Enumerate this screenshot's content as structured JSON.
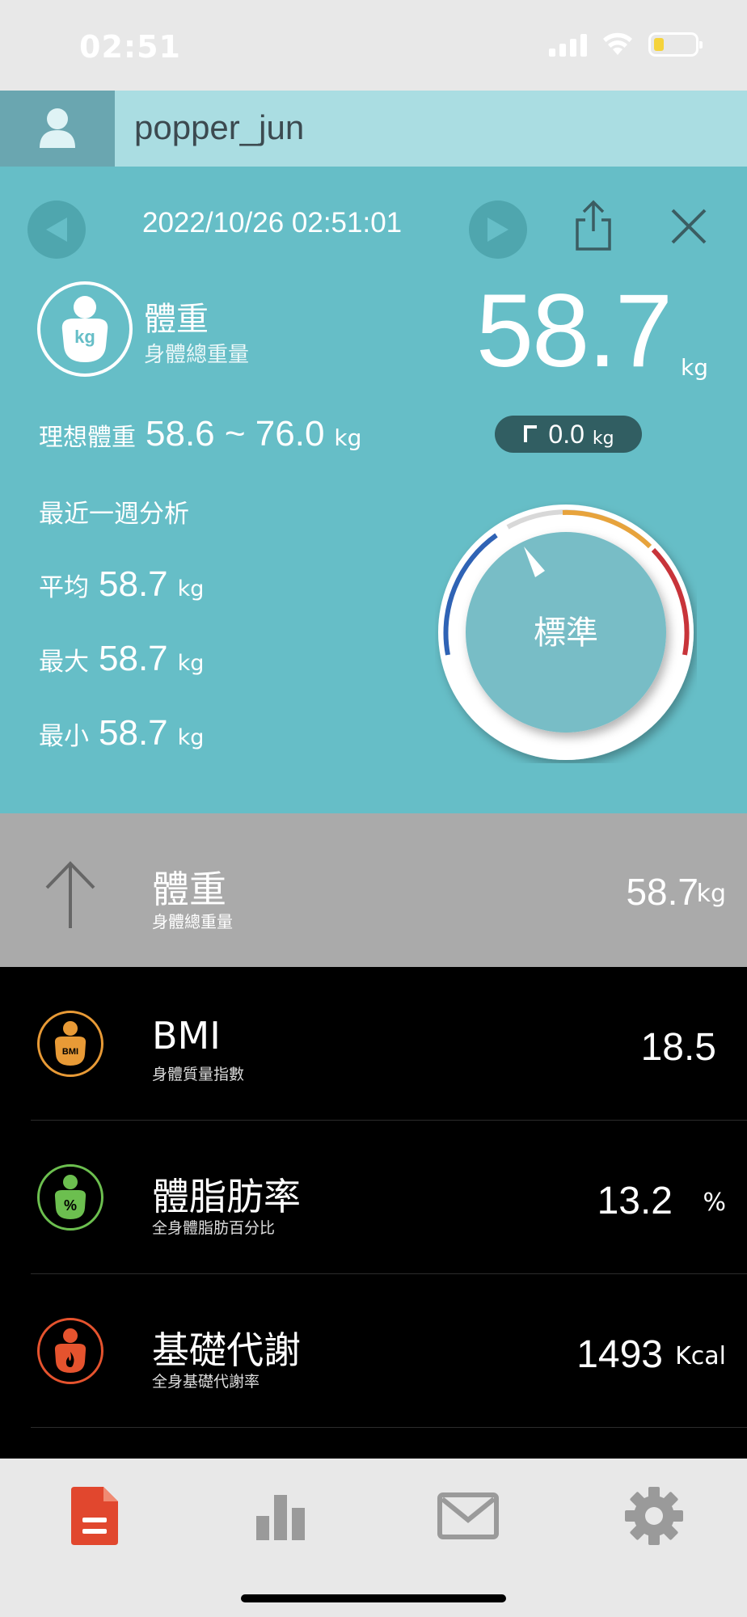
{
  "status_bar": {
    "time": "02:51"
  },
  "user": {
    "name": "popper_jun"
  },
  "header": {
    "datetime": "2022/10/26 02:51:01"
  },
  "weight": {
    "title": "體重",
    "subtitle": "身體總重量",
    "badge_text": "kg",
    "value": "58.7",
    "unit": "kg"
  },
  "ideal": {
    "label": "理想體重",
    "range": "58.6 ~ 76.0",
    "unit": "kg"
  },
  "delta": {
    "value": "0.0",
    "unit": "kg"
  },
  "week": {
    "title": "最近一週分析",
    "stats": [
      {
        "label": "平均",
        "value": "58.7",
        "unit": "kg"
      },
      {
        "label": "最大",
        "value": "58.7",
        "unit": "kg"
      },
      {
        "label": "最小",
        "value": "58.7",
        "unit": "kg"
      }
    ]
  },
  "gauge": {
    "label": "標準",
    "colors": {
      "low": "#2f63b5",
      "normal": "#e7a33c",
      "high": "#c8343a"
    }
  },
  "highlight": {
    "title": "體重",
    "subtitle": "身體總重量",
    "value": "58.7",
    "unit": "kg"
  },
  "list": [
    {
      "title": "BMI",
      "subtitle": "身體質量指數",
      "value": "18.5",
      "unit": "",
      "icon": "bmi-icon",
      "badge_text": "BMI",
      "color": "#e89a36"
    },
    {
      "title": "體脂肪率",
      "subtitle": "全身體脂肪百分比",
      "value": "13.2",
      "unit": "%",
      "icon": "body-fat-icon",
      "badge_text": "%",
      "color": "#6cbf4f"
    },
    {
      "title": "基礎代謝",
      "subtitle": "全身基礎代謝率",
      "value": "1493",
      "unit": "Kcal",
      "icon": "metabolism-icon",
      "badge_text": "",
      "color": "#e5532e"
    }
  ],
  "tabs": [
    {
      "name": "report",
      "icon": "report-icon",
      "active": true,
      "color": "#e1472e"
    },
    {
      "name": "chart",
      "icon": "bar-chart-icon",
      "active": false,
      "color": "#9a9a9a"
    },
    {
      "name": "mail",
      "icon": "mail-icon",
      "active": false,
      "color": "#9a9a9a"
    },
    {
      "name": "settings",
      "icon": "gear-icon",
      "active": false,
      "color": "#9a9a9a"
    }
  ]
}
